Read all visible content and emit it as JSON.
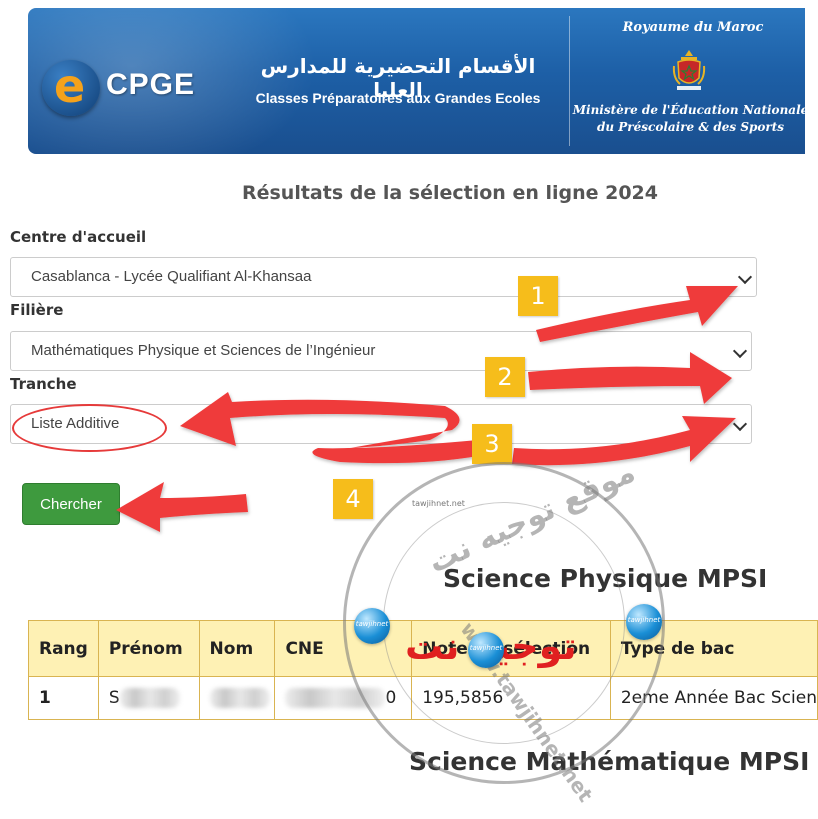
{
  "banner": {
    "logo_letter": "e",
    "logo_text": "CPGE",
    "arabic_title": "الأقسام التحضيرية للمدارس العليا",
    "french_title": "Classes Préparatoires aux Grandes Ecoles",
    "royaume": "Royaume du Maroc",
    "ministere_line1": "Ministère de l'Éducation Nationale",
    "ministere_line2": "du Préscolaire & des Sports"
  },
  "page": {
    "title": "Résultats de la sélection en ligne 2024"
  },
  "form": {
    "centre_label": "Centre d'accueil",
    "centre_value": "Casablanca - Lycée Qualifiant Al-Khansaa",
    "filiere_label": "Filière",
    "filiere_value": "Mathématiques Physique et Sciences de l’Ingénieur",
    "tranche_label": "Tranche",
    "tranche_value": "Liste Additive",
    "search_button": "Chercher"
  },
  "results": {
    "section1_title": "Science Physique MPSI",
    "section2_title": "Science Mathématique MPSI",
    "columns": [
      "Rang",
      "Prénom",
      "Nom",
      "CNE",
      "Note de sélection",
      "Type de bac"
    ],
    "rows": [
      {
        "rang": "1",
        "prenom_initial": "S",
        "cne_suffix": "0",
        "note": "195,5856",
        "type_bac": "2eme Année Bac Scien"
      }
    ]
  },
  "annotations": {
    "step1": "1",
    "step2": "2",
    "step3": "3",
    "step4": "4",
    "arrow_color": "#ef3b3b",
    "badge_color": "#f6bd1b"
  },
  "watermark": {
    "arabic_top": "موقع توجيه نت",
    "arabic_red": "توجيه نت",
    "latin": "www.tawjihnet.net",
    "ball_label": "tawjihnet",
    "ball_small": "tawjihnet.net"
  }
}
